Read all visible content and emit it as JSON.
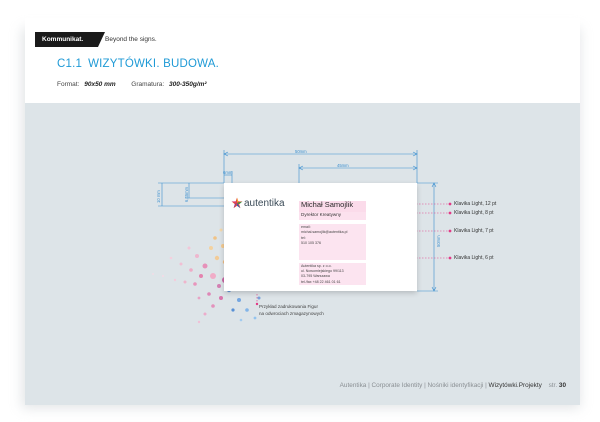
{
  "header": {
    "brand": "Kommunikat.",
    "tagline": "Beyond the signs.",
    "section_number": "C1.1",
    "section_title": "WIZYTÓWKI. BUDOWA.",
    "format_label": "Format:",
    "format_value": "90x50 mm",
    "weight_label": "Gramatura:",
    "weight_value": "300-350g/m²"
  },
  "dimensions": {
    "card_width": "50mm",
    "text_width": "45mm",
    "left_margin": "6mm",
    "height": "50mm",
    "top_margin": "10 mm",
    "logo_offset": "6,45mm"
  },
  "card": {
    "logo_text": "autentika",
    "name": "Michał Samojlik",
    "title": "Dyrektor Kreatywny",
    "contact_lines": [
      "email:",
      "michal.samojlik@autentika.pl",
      "tel:",
      "510 105 376"
    ],
    "address_lines": [
      "Autentika sp. z o.o.",
      "ul. Nowomiejskiego 99/113",
      "03-795 Warszawa",
      "tel./fax +48 22 461 01 61"
    ]
  },
  "font_specs": [
    "Klavika Light, 12 pt",
    "Klavika Light, 8 pt",
    "Klavika Light, 7 pt",
    "Klavika Light, 6 pt"
  ],
  "callout": {
    "line1": "Przykład zadrukowania Figur",
    "line2": "na odwrociach zmagazynowych"
  },
  "footer": {
    "crumbs": "Autentika | Corporate Identity | Nośniki identyfikacji |",
    "current": "Wizytówki.Projekty",
    "page_label": "str.",
    "page_number": "30"
  },
  "colors": {
    "accent": "#1f9ad6",
    "guide": "#e23a86",
    "background": "#dde4e8"
  }
}
